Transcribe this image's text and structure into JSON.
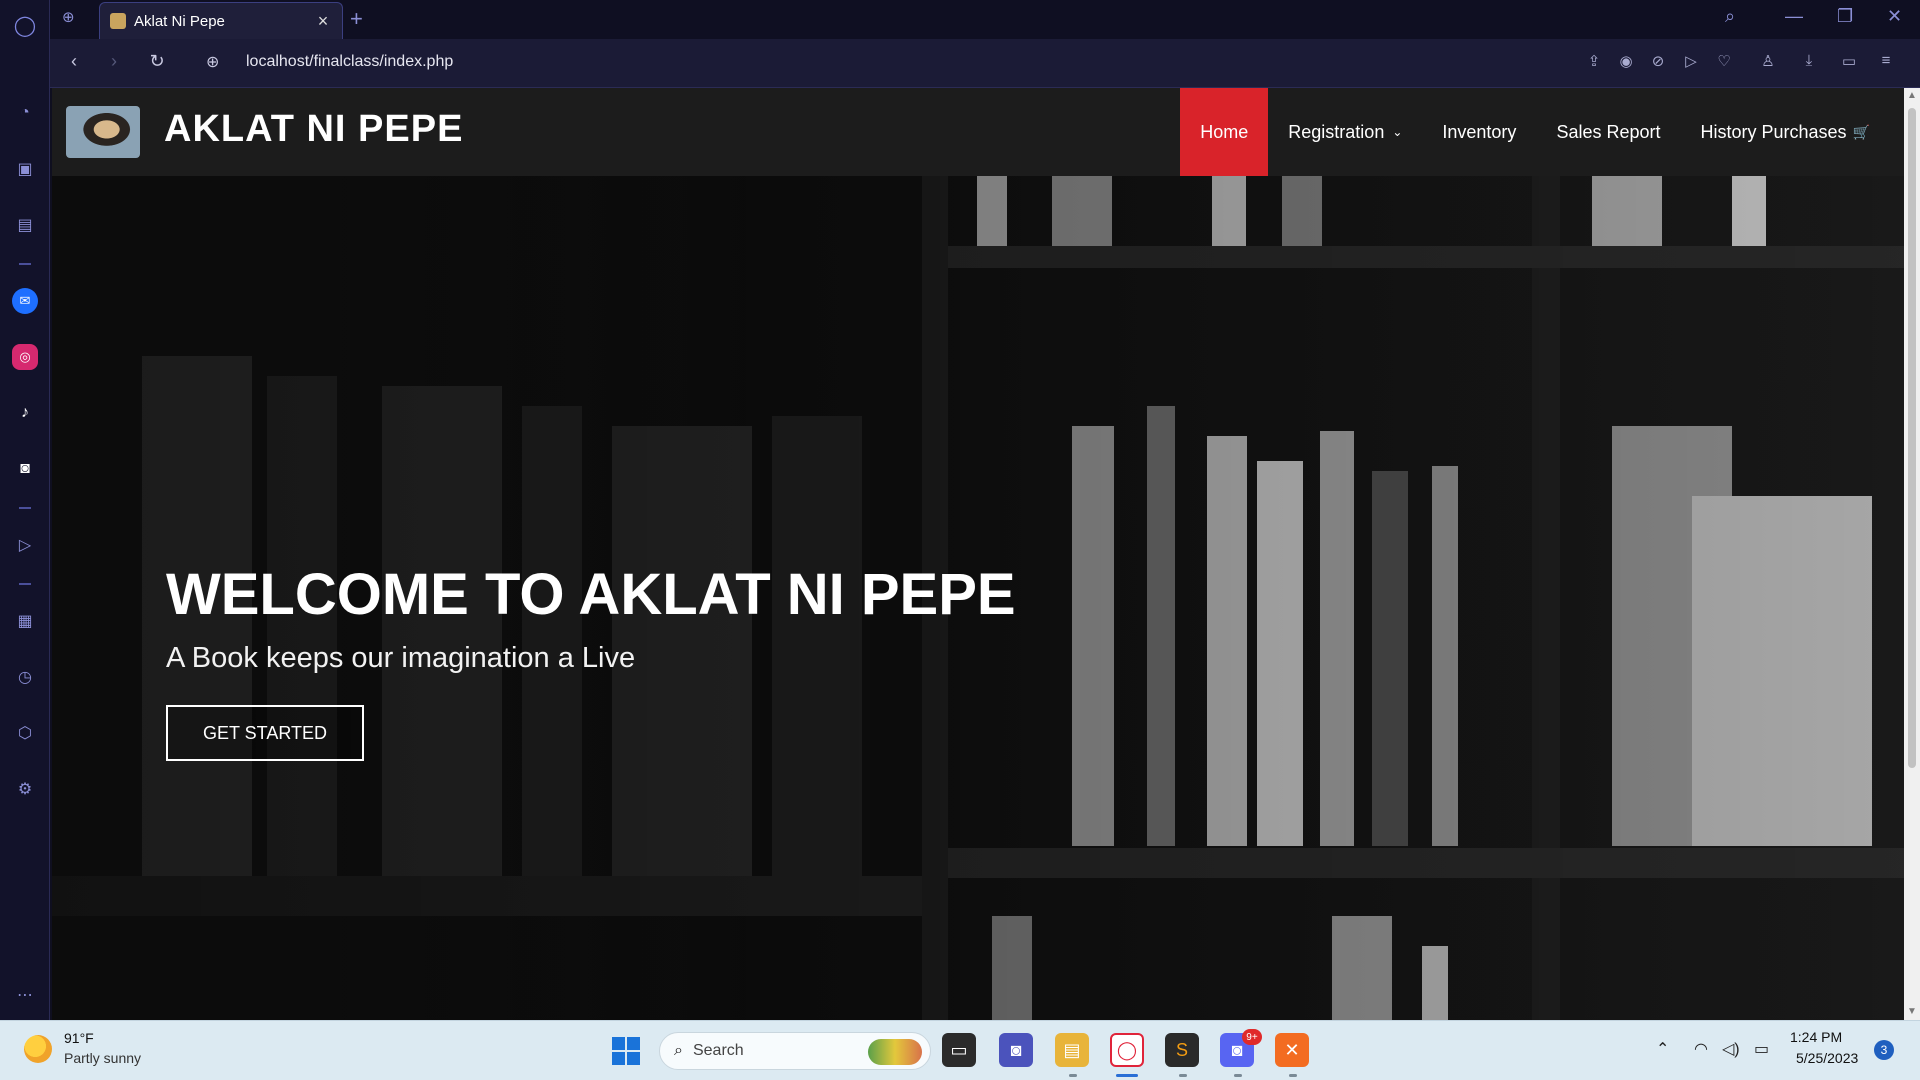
{
  "browser": {
    "tab": {
      "title": "Aklat Ni Pepe"
    },
    "url": "localhost/finalclass/index.php",
    "accent": "#3b3f80"
  },
  "site": {
    "brand": "AKLAT NI PEPE",
    "nav": [
      {
        "label": "Home",
        "active": true
      },
      {
        "label": "Registration",
        "dropdown": true
      },
      {
        "label": "Inventory"
      },
      {
        "label": "Sales Report"
      },
      {
        "label": "History Purchases",
        "icon": "cart-icon"
      }
    ],
    "active_color": "#d9232a",
    "hero": {
      "title": "WELCOME TO AKLAT NI PEPE",
      "subtitle": "A Book keeps our imagination a Live",
      "cta": "GET STARTED"
    }
  },
  "taskbar": {
    "weather": {
      "temp": "91°F",
      "desc": "Partly sunny"
    },
    "search_placeholder": "Search",
    "discord_badge": "9+",
    "clock": {
      "time": "1:24 PM",
      "date": "5/25/2023"
    },
    "notifications": "3"
  }
}
